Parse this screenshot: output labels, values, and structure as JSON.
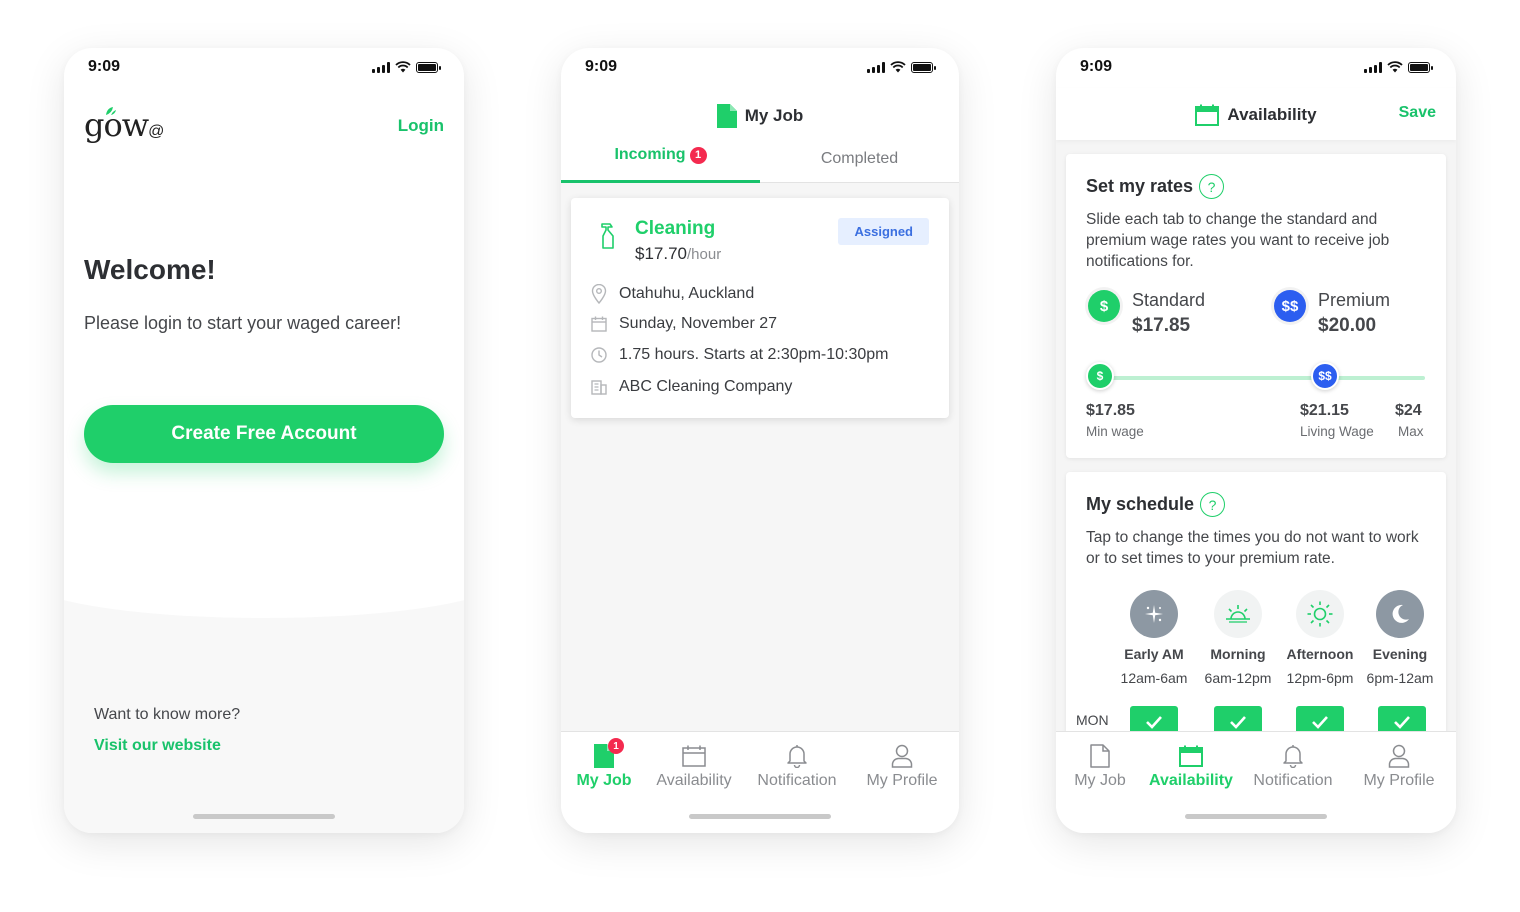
{
  "status_time": "9:09",
  "phone1": {
    "logo": "gow",
    "logo_suffix": "@",
    "login": "Login",
    "welcome": "Welcome!",
    "subtitle": "Please login to start your waged career!",
    "cta": "Create Free Account",
    "more": "Want to know more?",
    "visit": "Visit our website"
  },
  "phone2": {
    "title": "My Job",
    "tabs": [
      {
        "label": "Incoming",
        "badge": "1"
      },
      {
        "label": "Completed"
      }
    ],
    "job": {
      "title": "Cleaning",
      "rate": "$17.70",
      "rate_unit": "/hour",
      "status": "Assigned",
      "location": "Otahuhu, Auckland",
      "date": "Sunday, November 27",
      "hours": "1.75 hours. Starts at 2:30pm-10:30pm",
      "company": "ABC Cleaning Company"
    },
    "nav": [
      {
        "label": "My Job",
        "badge": "1"
      },
      {
        "label": "Availability"
      },
      {
        "label": "Notification"
      },
      {
        "label": "My Profile"
      }
    ]
  },
  "phone3": {
    "title": "Availability",
    "save": "Save",
    "rates": {
      "heading": "Set my rates",
      "help": "?",
      "description": "Slide each tab to change the standard and premium wage rates you want to receive job notifications for.",
      "standard": {
        "label": "Standard",
        "value": "$17.85",
        "symbol": "$"
      },
      "premium": {
        "label": "Premium",
        "value": "$20.00",
        "symbol": "$$"
      },
      "ticks": [
        {
          "value": "$17.85",
          "label": "Min wage"
        },
        {
          "value": "$21.15",
          "label": "Living Wage"
        },
        {
          "value": "$24",
          "label": "Max"
        }
      ]
    },
    "schedule": {
      "heading": "My schedule",
      "help": "?",
      "description": "Tap to change the times you do not want to work or to set times to your premium rate.",
      "slots": [
        {
          "name": "Early AM",
          "hours": "12am-6am",
          "icon": "sparkle-icon"
        },
        {
          "name": "Morning",
          "hours": "6am-12pm",
          "icon": "sunrise-icon"
        },
        {
          "name": "Afternoon",
          "hours": "12pm-6pm",
          "icon": "sun-icon"
        },
        {
          "name": "Evening",
          "hours": "6pm-12am",
          "icon": "moon-icon"
        }
      ],
      "day": "MON"
    },
    "nav": [
      {
        "label": "My Job"
      },
      {
        "label": "Availability"
      },
      {
        "label": "Notification"
      },
      {
        "label": "My Profile"
      }
    ]
  },
  "colors": {
    "accent": "#1fcf6a",
    "blue": "#2c5ef0",
    "badge": "#f42a4f"
  }
}
